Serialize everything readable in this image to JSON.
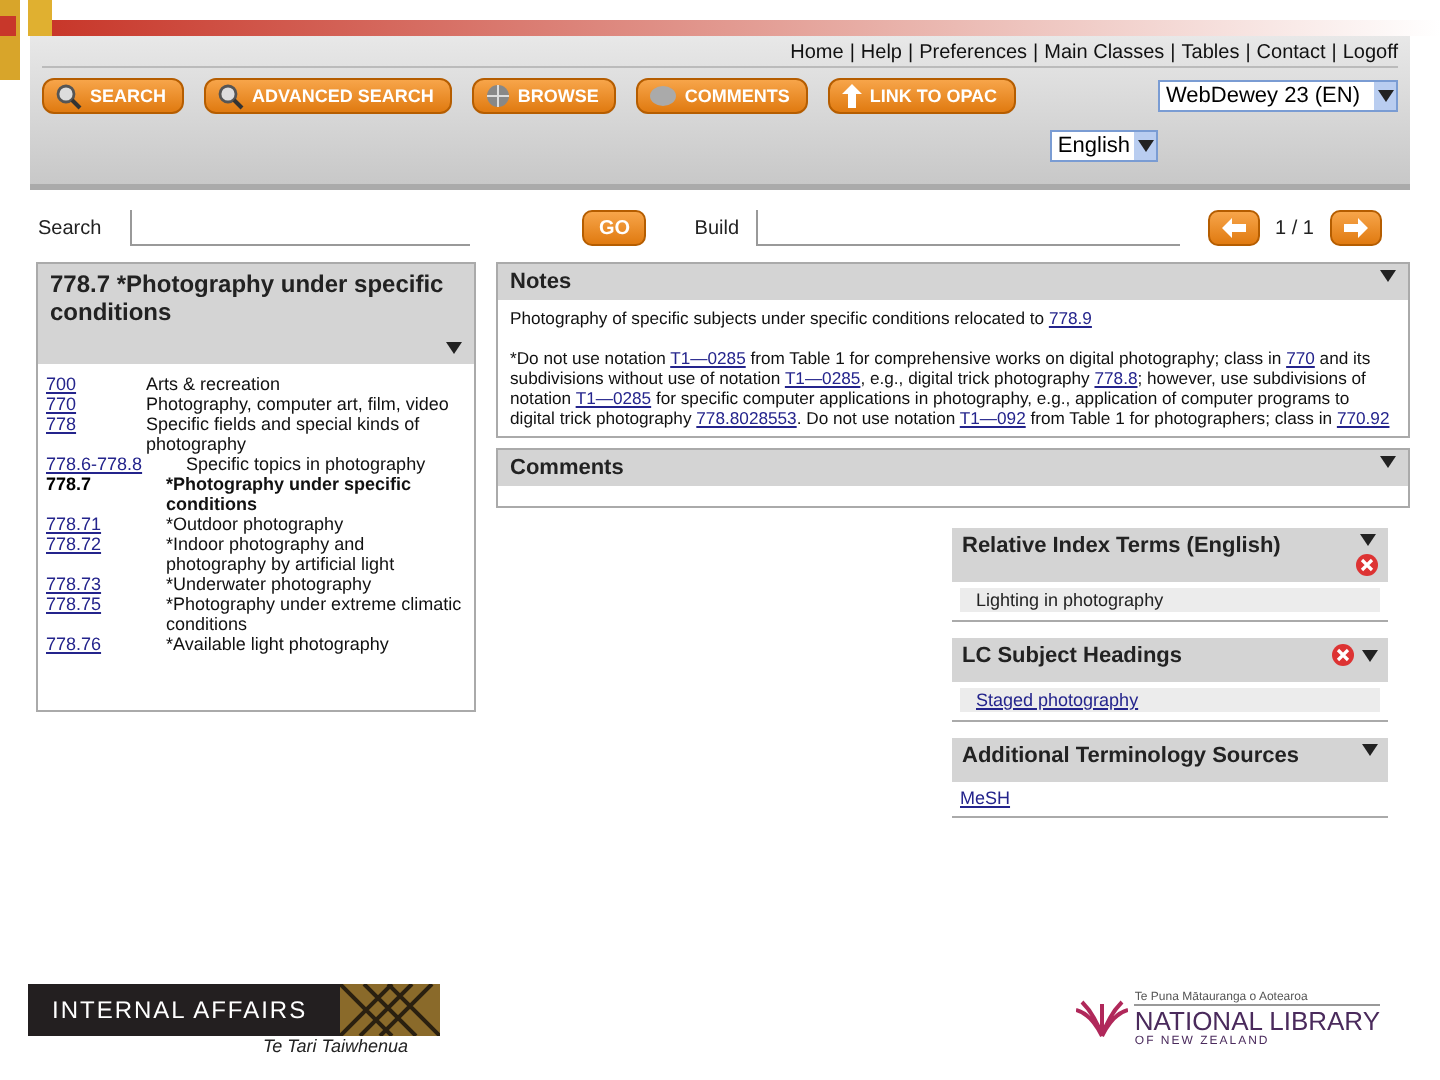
{
  "top_links": {
    "separator": "|",
    "items": [
      "Home",
      "Help",
      "Preferences",
      "Main Classes",
      "Tables",
      "Contact",
      "Logoff"
    ]
  },
  "nav_buttons": [
    {
      "label": "SEARCH"
    },
    {
      "label": "ADVANCED SEARCH"
    },
    {
      "label": "BROWSE"
    },
    {
      "label": "COMMENTS"
    },
    {
      "label": "LINK TO OPAC"
    }
  ],
  "edition_select": {
    "value": "WebDewey 23 (EN)"
  },
  "language_select": {
    "value": "English"
  },
  "search_bar": {
    "search_label": "Search",
    "go_button": "GO",
    "build_label": "Build",
    "page": "1 / 1"
  },
  "hierarchy": {
    "title": "778.7 *Photography under specific conditions",
    "items": [
      {
        "code": "700",
        "text": "Arts & recreation",
        "current": false,
        "children": [
          {
            "code": "770",
            "text": "Photography, computer art, film, video",
            "current": false,
            "children": [
              {
                "code": "778",
                "text": "Specific fields and special kinds of photography",
                "current": false,
                "children": [
                  {
                    "code": "778.6-778.8",
                    "text": "Specific topics in photography",
                    "current": false,
                    "children": [
                      {
                        "code": "778.7",
                        "text": "*Photography under specific conditions",
                        "current": true,
                        "children": [
                          {
                            "code": "778.71",
                            "text": "*Outdoor photography",
                            "current": false
                          },
                          {
                            "code": "778.72",
                            "text": "*Indoor photography and photography by artificial light",
                            "current": false
                          },
                          {
                            "code": "778.73",
                            "text": "*Underwater photography",
                            "current": false
                          },
                          {
                            "code": "778.75",
                            "text": "*Photography under extreme climatic conditions",
                            "current": false
                          },
                          {
                            "code": "778.76",
                            "text": "*Available light photography",
                            "current": false
                          }
                        ]
                      }
                    ]
                  }
                ]
              }
            ]
          }
        ]
      }
    ]
  },
  "notes": {
    "title": "Notes",
    "paragraphs": [
      [
        {
          "kind": "text",
          "text": "Photography of specific subjects under specific conditions relocated to "
        },
        {
          "kind": "link",
          "text": "778.9"
        }
      ],
      [
        {
          "kind": "text",
          "text": "*Do not use notation "
        },
        {
          "kind": "link",
          "text": "T1—0285"
        },
        {
          "kind": "text",
          "text": " from Table 1 for comprehensive works on digital photography; class in "
        },
        {
          "kind": "link",
          "text": "770"
        },
        {
          "kind": "text",
          "text": " and its subdivisions without use of notation "
        },
        {
          "kind": "link",
          "text": "T1—0285"
        },
        {
          "kind": "text",
          "text": ", e.g., digital trick photography "
        },
        {
          "kind": "link",
          "text": "778.8"
        },
        {
          "kind": "text",
          "text": "; however, use subdivisions of notation "
        },
        {
          "kind": "link",
          "text": "T1—0285"
        },
        {
          "kind": "text",
          "text": " for specific computer applications in photography, e.g., application of computer programs to digital trick photography "
        },
        {
          "kind": "link",
          "text": "778.8028553"
        },
        {
          "kind": "text",
          "text": ". Do not use notation "
        },
        {
          "kind": "link",
          "text": "T1—092"
        },
        {
          "kind": "text",
          "text": " from Table 1 for photographers; class in "
        },
        {
          "kind": "link",
          "text": "770.92"
        }
      ]
    ]
  },
  "comments": {
    "title": "Comments"
  },
  "side_panels": [
    {
      "title": "Relative Index Terms (English)",
      "closable": true,
      "items": [
        {
          "text": "Lighting in photography",
          "link": false
        }
      ]
    },
    {
      "title": "LC Subject Headings",
      "closable": true,
      "items": [
        {
          "text": "Staged photography",
          "link": true
        }
      ]
    },
    {
      "title": "Additional Terminology Sources",
      "closable": false,
      "items": [
        {
          "text": "MeSH",
          "link": true
        }
      ]
    }
  ],
  "footer": {
    "left_logo": {
      "name": "INTERNAL AFFAIRS",
      "subtitle": "Te Tari Taiwhenua"
    },
    "right_logo": {
      "tagline": "Te Puna Mātauranga o Aotearoa",
      "name": "NATIONAL LIBRARY",
      "subtitle": "OF NEW ZEALAND"
    }
  }
}
